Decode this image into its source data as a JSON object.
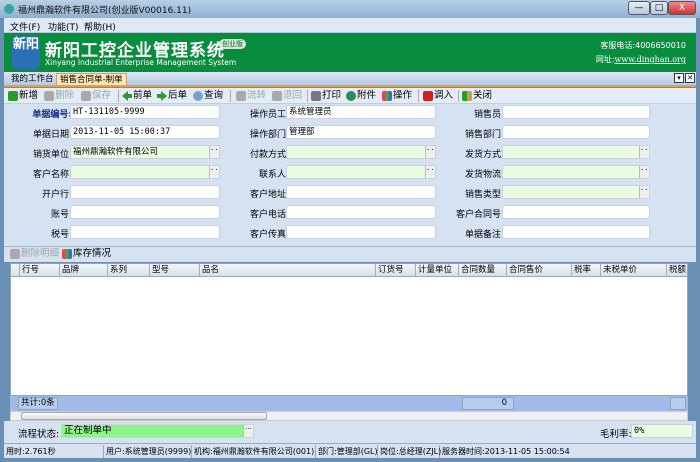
{
  "window": {
    "title": "福州鼎瀚软件有限公司(创业版V00016.11)",
    "min": "—",
    "max": "□",
    "close": "X"
  },
  "menu": [
    "文件(F)",
    "功能(T)",
    "帮助(H)"
  ],
  "banner": {
    "logo": "新阳",
    "title": "新阳工控企业管理系统",
    "edition": "创业版",
    "subtitle": "Xinyang Industrial Enterprise Management System",
    "phone": "客服电话:4006650010",
    "site_label": "网址:",
    "site_url": "www.dinghan.org"
  },
  "tabs": [
    {
      "label": "我的工作台"
    },
    {
      "label": "销售合同单-制单",
      "active": true
    }
  ],
  "toolbar": [
    {
      "label": "新增",
      "icon": "plus-icon",
      "color": "#2a9a2a"
    },
    {
      "label": "删除",
      "icon": "delete-icon",
      "disabled": true,
      "color": "#999"
    },
    {
      "label": "保存",
      "icon": "save-icon",
      "disabled": true,
      "color": "#999"
    },
    {
      "label": "前单",
      "icon": "arrow-left-icon",
      "color": "#2a9a2a"
    },
    {
      "label": "后单",
      "icon": "arrow-right-icon",
      "color": "#2a9a2a"
    },
    {
      "label": "查询",
      "icon": "search-icon",
      "color": "#4a7ab8"
    },
    {
      "label": "流转",
      "icon": "flow-icon",
      "disabled": true,
      "color": "#999"
    },
    {
      "label": "退回",
      "icon": "return-icon",
      "disabled": true,
      "color": "#999"
    },
    {
      "label": "打印",
      "icon": "print-icon",
      "color": "#556"
    },
    {
      "label": "附件",
      "icon": "attachment-icon",
      "color": "#2a8a5a"
    },
    {
      "label": "操作",
      "icon": "chart-icon",
      "color": "#4a6ab8"
    },
    {
      "label": "调入",
      "icon": "import-icon",
      "color": "#d02020"
    },
    {
      "label": "关闭",
      "icon": "exit-icon",
      "color": "#2a9a2a"
    }
  ],
  "form": {
    "col1": [
      {
        "label": "单据编号:",
        "value": "HT-131105-9999",
        "bold": true
      },
      {
        "label": "单据日期:",
        "value": "2013-11-05 15:00:37"
      },
      {
        "label": "销货单位:",
        "value": "福州鼎瀚软件有限公司",
        "lookup": true
      },
      {
        "label": "客户名称:",
        "value": "",
        "lookup": true
      },
      {
        "label": "开户行:",
        "value": ""
      },
      {
        "label": "账号:",
        "value": ""
      },
      {
        "label": "税号:",
        "value": ""
      }
    ],
    "col2": [
      {
        "label": "操作员工:",
        "value": "系统管理员"
      },
      {
        "label": "操作部门:",
        "value": "管理部"
      },
      {
        "label": "付款方式:",
        "value": "",
        "lookup": true
      },
      {
        "label": "联系人:",
        "value": "",
        "lookup": true
      },
      {
        "label": "客户地址:",
        "value": ""
      },
      {
        "label": "客户电话:",
        "value": ""
      },
      {
        "label": "客户传真:",
        "value": ""
      }
    ],
    "col3": [
      {
        "label": "销售员:",
        "value": ""
      },
      {
        "label": "销售部门:",
        "value": ""
      },
      {
        "label": "发货方式:",
        "value": "",
        "lookup": true
      },
      {
        "label": "发货物流:",
        "value": "",
        "lookup": true
      },
      {
        "label": "销售类型:",
        "value": "",
        "lookup": true
      },
      {
        "label": "客户合同号:",
        "value": ""
      },
      {
        "label": "单据备注:",
        "value": ""
      }
    ]
  },
  "detail_toolbar": {
    "delete": "删除明细",
    "stock": "库存情况"
  },
  "grid": {
    "columns": [
      "行号",
      "品牌",
      "系列",
      "型号",
      "品名",
      "订货号",
      "计量单位",
      "合同数量",
      "合同售价",
      "税率",
      "未税单价",
      "税额"
    ],
    "rows": [],
    "total_label": "共计:0条",
    "total_qty": "0"
  },
  "flow": {
    "label": "流程状态:",
    "value": "正在制单中",
    "margin_label": "毛利率:",
    "margin_value": "0%"
  },
  "status": [
    "用时:2.761秒",
    "用户:系统管理员(9999)",
    "机构:福州鼎瀚软件有限公司(001)",
    "部门:管理部(GL)",
    "岗位:总经理(ZJL)",
    "服务器时间:2013-11-05 15:00:54"
  ]
}
